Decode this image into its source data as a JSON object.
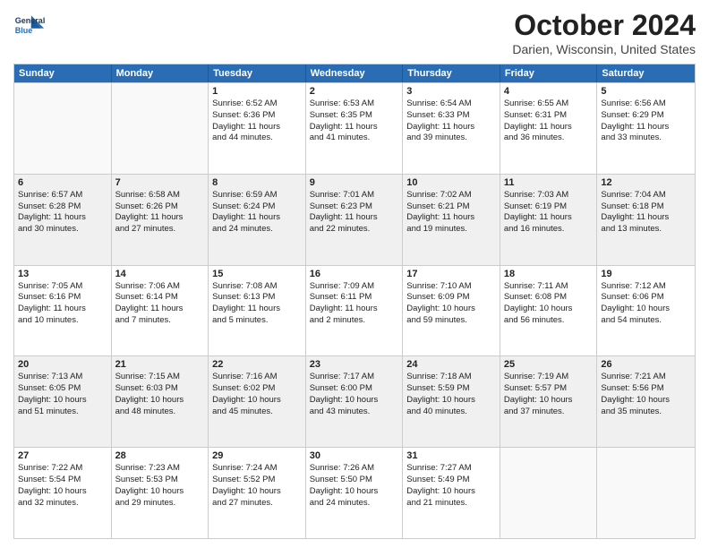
{
  "header": {
    "logo_line1": "General",
    "logo_line2": "Blue",
    "month": "October 2024",
    "location": "Darien, Wisconsin, United States"
  },
  "days_of_week": [
    "Sunday",
    "Monday",
    "Tuesday",
    "Wednesday",
    "Thursday",
    "Friday",
    "Saturday"
  ],
  "weeks": [
    [
      {
        "day": "",
        "lines": [],
        "empty": true
      },
      {
        "day": "",
        "lines": [],
        "empty": true
      },
      {
        "day": "1",
        "lines": [
          "Sunrise: 6:52 AM",
          "Sunset: 6:36 PM",
          "Daylight: 11 hours",
          "and 44 minutes."
        ]
      },
      {
        "day": "2",
        "lines": [
          "Sunrise: 6:53 AM",
          "Sunset: 6:35 PM",
          "Daylight: 11 hours",
          "and 41 minutes."
        ]
      },
      {
        "day": "3",
        "lines": [
          "Sunrise: 6:54 AM",
          "Sunset: 6:33 PM",
          "Daylight: 11 hours",
          "and 39 minutes."
        ]
      },
      {
        "day": "4",
        "lines": [
          "Sunrise: 6:55 AM",
          "Sunset: 6:31 PM",
          "Daylight: 11 hours",
          "and 36 minutes."
        ]
      },
      {
        "day": "5",
        "lines": [
          "Sunrise: 6:56 AM",
          "Sunset: 6:29 PM",
          "Daylight: 11 hours",
          "and 33 minutes."
        ]
      }
    ],
    [
      {
        "day": "6",
        "lines": [
          "Sunrise: 6:57 AM",
          "Sunset: 6:28 PM",
          "Daylight: 11 hours",
          "and 30 minutes."
        ]
      },
      {
        "day": "7",
        "lines": [
          "Sunrise: 6:58 AM",
          "Sunset: 6:26 PM",
          "Daylight: 11 hours",
          "and 27 minutes."
        ]
      },
      {
        "day": "8",
        "lines": [
          "Sunrise: 6:59 AM",
          "Sunset: 6:24 PM",
          "Daylight: 11 hours",
          "and 24 minutes."
        ]
      },
      {
        "day": "9",
        "lines": [
          "Sunrise: 7:01 AM",
          "Sunset: 6:23 PM",
          "Daylight: 11 hours",
          "and 22 minutes."
        ]
      },
      {
        "day": "10",
        "lines": [
          "Sunrise: 7:02 AM",
          "Sunset: 6:21 PM",
          "Daylight: 11 hours",
          "and 19 minutes."
        ]
      },
      {
        "day": "11",
        "lines": [
          "Sunrise: 7:03 AM",
          "Sunset: 6:19 PM",
          "Daylight: 11 hours",
          "and 16 minutes."
        ]
      },
      {
        "day": "12",
        "lines": [
          "Sunrise: 7:04 AM",
          "Sunset: 6:18 PM",
          "Daylight: 11 hours",
          "and 13 minutes."
        ]
      }
    ],
    [
      {
        "day": "13",
        "lines": [
          "Sunrise: 7:05 AM",
          "Sunset: 6:16 PM",
          "Daylight: 11 hours",
          "and 10 minutes."
        ]
      },
      {
        "day": "14",
        "lines": [
          "Sunrise: 7:06 AM",
          "Sunset: 6:14 PM",
          "Daylight: 11 hours",
          "and 7 minutes."
        ]
      },
      {
        "day": "15",
        "lines": [
          "Sunrise: 7:08 AM",
          "Sunset: 6:13 PM",
          "Daylight: 11 hours",
          "and 5 minutes."
        ]
      },
      {
        "day": "16",
        "lines": [
          "Sunrise: 7:09 AM",
          "Sunset: 6:11 PM",
          "Daylight: 11 hours",
          "and 2 minutes."
        ]
      },
      {
        "day": "17",
        "lines": [
          "Sunrise: 7:10 AM",
          "Sunset: 6:09 PM",
          "Daylight: 10 hours",
          "and 59 minutes."
        ]
      },
      {
        "day": "18",
        "lines": [
          "Sunrise: 7:11 AM",
          "Sunset: 6:08 PM",
          "Daylight: 10 hours",
          "and 56 minutes."
        ]
      },
      {
        "day": "19",
        "lines": [
          "Sunrise: 7:12 AM",
          "Sunset: 6:06 PM",
          "Daylight: 10 hours",
          "and 54 minutes."
        ]
      }
    ],
    [
      {
        "day": "20",
        "lines": [
          "Sunrise: 7:13 AM",
          "Sunset: 6:05 PM",
          "Daylight: 10 hours",
          "and 51 minutes."
        ]
      },
      {
        "day": "21",
        "lines": [
          "Sunrise: 7:15 AM",
          "Sunset: 6:03 PM",
          "Daylight: 10 hours",
          "and 48 minutes."
        ]
      },
      {
        "day": "22",
        "lines": [
          "Sunrise: 7:16 AM",
          "Sunset: 6:02 PM",
          "Daylight: 10 hours",
          "and 45 minutes."
        ]
      },
      {
        "day": "23",
        "lines": [
          "Sunrise: 7:17 AM",
          "Sunset: 6:00 PM",
          "Daylight: 10 hours",
          "and 43 minutes."
        ]
      },
      {
        "day": "24",
        "lines": [
          "Sunrise: 7:18 AM",
          "Sunset: 5:59 PM",
          "Daylight: 10 hours",
          "and 40 minutes."
        ]
      },
      {
        "day": "25",
        "lines": [
          "Sunrise: 7:19 AM",
          "Sunset: 5:57 PM",
          "Daylight: 10 hours",
          "and 37 minutes."
        ]
      },
      {
        "day": "26",
        "lines": [
          "Sunrise: 7:21 AM",
          "Sunset: 5:56 PM",
          "Daylight: 10 hours",
          "and 35 minutes."
        ]
      }
    ],
    [
      {
        "day": "27",
        "lines": [
          "Sunrise: 7:22 AM",
          "Sunset: 5:54 PM",
          "Daylight: 10 hours",
          "and 32 minutes."
        ]
      },
      {
        "day": "28",
        "lines": [
          "Sunrise: 7:23 AM",
          "Sunset: 5:53 PM",
          "Daylight: 10 hours",
          "and 29 minutes."
        ]
      },
      {
        "day": "29",
        "lines": [
          "Sunrise: 7:24 AM",
          "Sunset: 5:52 PM",
          "Daylight: 10 hours",
          "and 27 minutes."
        ]
      },
      {
        "day": "30",
        "lines": [
          "Sunrise: 7:26 AM",
          "Sunset: 5:50 PM",
          "Daylight: 10 hours",
          "and 24 minutes."
        ]
      },
      {
        "day": "31",
        "lines": [
          "Sunrise: 7:27 AM",
          "Sunset: 5:49 PM",
          "Daylight: 10 hours",
          "and 21 minutes."
        ]
      },
      {
        "day": "",
        "lines": [],
        "empty": true
      },
      {
        "day": "",
        "lines": [],
        "empty": true
      }
    ]
  ]
}
